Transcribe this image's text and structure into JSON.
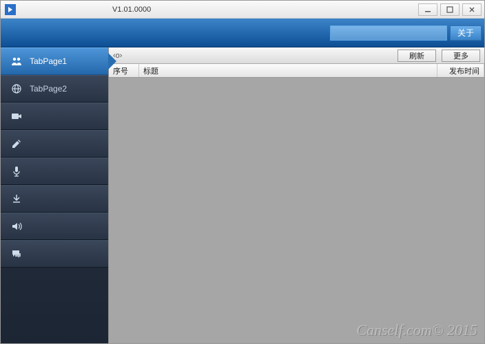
{
  "titlebar": {
    "version": "V1.01.0000"
  },
  "header": {
    "search_placeholder": "",
    "about_label": "关于"
  },
  "sidebar": {
    "items": [
      {
        "label": "TabPage1",
        "icon": "people-icon"
      },
      {
        "label": "TabPage2",
        "icon": "globe-icon"
      },
      {
        "label": "",
        "icon": "camera-icon"
      },
      {
        "label": "",
        "icon": "edit-icon"
      },
      {
        "label": "",
        "icon": "mic-icon"
      },
      {
        "label": "",
        "icon": "download-icon"
      },
      {
        "label": "",
        "icon": "sound-icon"
      },
      {
        "label": "",
        "icon": "chat-icon"
      }
    ]
  },
  "toolbar": {
    "breadcrumb_symbol": "‹o›",
    "refresh_label": "刷新",
    "more_label": "更多"
  },
  "table": {
    "columns": {
      "seq": "序号",
      "title": "标题",
      "pub": "发布时间"
    }
  },
  "watermark": "Canself.com© 2015"
}
